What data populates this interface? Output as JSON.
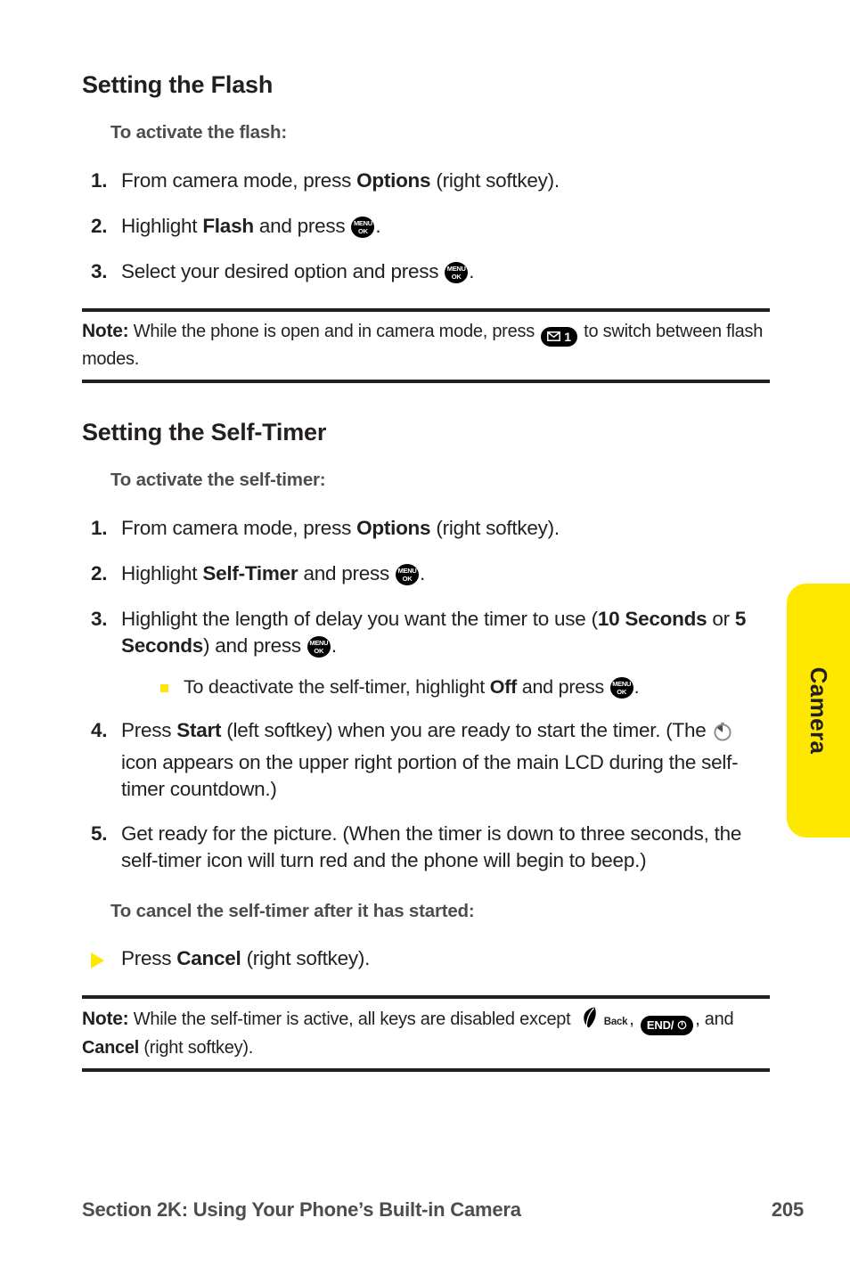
{
  "side_tab": {
    "label": "Camera",
    "color": "#ffe800"
  },
  "sections": [
    {
      "heading": "Setting the Flash",
      "subheading": "To activate the flash:",
      "steps": [
        {
          "num": "1.",
          "pre": "From camera mode, press ",
          "bold": "Options",
          "post": " (right softkey)."
        },
        {
          "num": "2.",
          "pre": "Highlight ",
          "bold": "Flash",
          "post": " and press ",
          "icon": "menu-ok-key",
          "tail": "."
        },
        {
          "num": "3.",
          "pre": "Select your desired option and press ",
          "icon": "menu-ok-key",
          "tail": "."
        }
      ]
    }
  ],
  "note_flash": {
    "label": "Note:",
    "text_before": " While the phone is open and in camera mode, press ",
    "key_icon": "message-1-key",
    "key_number": "1",
    "text_after": " to switch between flash modes."
  },
  "section_selftimer": {
    "heading": "Setting the Self-Timer",
    "subheading": "To activate the self-timer:",
    "steps": [
      {
        "num": "1.",
        "text_a": "From camera mode, press ",
        "bold_a": "Options",
        "text_b": " (right softkey)."
      },
      {
        "num": "2.",
        "text_a": "Highlight ",
        "bold_a": "Self-Timer",
        "text_b": " and press ",
        "icon": "menu-ok-key",
        "text_c": "."
      },
      {
        "num": "3.",
        "text_a": "Highlight the length of delay you want the timer to use (",
        "bold_a": "10 Seconds",
        "text_b": " or ",
        "bold_b": "5 Seconds",
        "text_c": ") and press ",
        "icon": "menu-ok-key",
        "text_d": "."
      },
      {
        "num": "4.",
        "text_a": "Press ",
        "bold_a": "Start",
        "text_b": " (left softkey) when you are ready to start the timer. (The ",
        "icon": "self-timer-stopwatch-icon",
        "text_c": " icon appears on the upper right portion of the main LCD during the self-timer countdown.)"
      },
      {
        "num": "5.",
        "text_a": "Get ready for the picture. (When the timer is down to three seconds, the self-timer icon will turn red and the phone will begin to beep.)"
      }
    ],
    "substep": {
      "text_a": "To deactivate the self-timer, highlight ",
      "bold_a": "Off",
      "text_b": " and press ",
      "icon": "menu-ok-key",
      "text_c": "."
    },
    "cancel_subheading": "To cancel the self-timer after it has started:",
    "cancel_step": {
      "text_a": "Press ",
      "bold_a": "Cancel",
      "text_b": " (right softkey)."
    }
  },
  "note_selftimer": {
    "label": "Note:",
    "text_before": " While the self-timer is active, all keys are disabled except ",
    "back_key_label": "Back",
    "text_middle": ", ",
    "end_key_label": "END/",
    "text_after_end": ", and ",
    "bold_cancel": "Cancel",
    "text_end": " (right softkey)."
  },
  "footer": {
    "section_title": "Section 2K: Using Your Phone’s Built-in Camera",
    "page_number": "205"
  }
}
